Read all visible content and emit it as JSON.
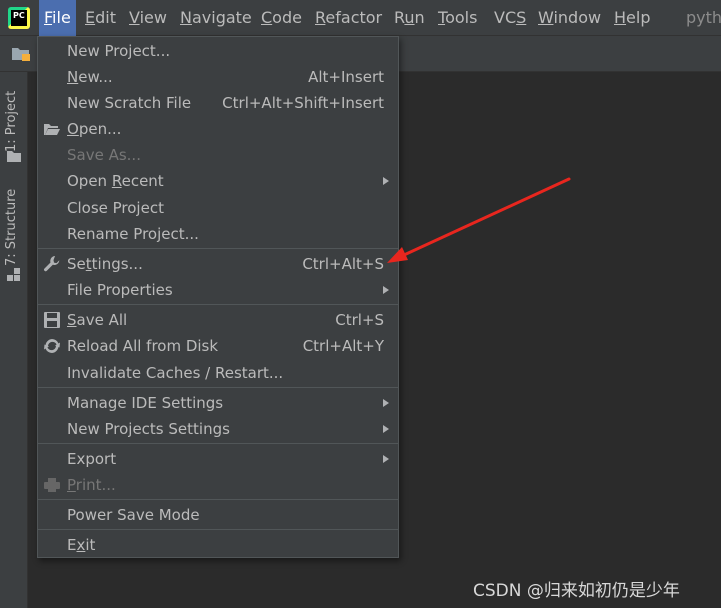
{
  "app": {
    "logo_text": "PC",
    "project_name": "pyth"
  },
  "menubar": [
    {
      "pre": "",
      "mn": "F",
      "post": "ile"
    },
    {
      "pre": "",
      "mn": "E",
      "post": "dit"
    },
    {
      "pre": "",
      "mn": "V",
      "post": "iew"
    },
    {
      "pre": "",
      "mn": "N",
      "post": "avigate"
    },
    {
      "pre": "",
      "mn": "C",
      "post": "ode"
    },
    {
      "pre": "",
      "mn": "R",
      "post": "efactor"
    },
    {
      "pre": "R",
      "mn": "u",
      "post": "n"
    },
    {
      "pre": "",
      "mn": "T",
      "post": "ools"
    },
    {
      "pre": "VC",
      "mn": "S",
      "post": ""
    },
    {
      "pre": "",
      "mn": "W",
      "post": "indow"
    },
    {
      "pre": "",
      "mn": "H",
      "post": "elp"
    }
  ],
  "sidebar": {
    "project_tab": "1: Project",
    "structure_tab": "7: Structure"
  },
  "file_menu": {
    "items": [
      {
        "pre": "New Project...",
        "mn": "",
        "post": "",
        "shortcut": ""
      },
      {
        "pre": "",
        "mn": "N",
        "post": "ew...",
        "shortcut": "Alt+Insert"
      },
      {
        "pre": "New Scratch File",
        "mn": "",
        "post": "",
        "shortcut": "Ctrl+Alt+Shift+Insert"
      },
      {
        "pre": "",
        "mn": "O",
        "post": "pen...",
        "shortcut": ""
      },
      {
        "pre": "Save As...",
        "mn": "",
        "post": "",
        "shortcut": ""
      },
      {
        "pre": "Open ",
        "mn": "R",
        "post": "ecent",
        "shortcut": ""
      },
      {
        "pre": "Close Project",
        "mn": "",
        "post": "",
        "shortcut": ""
      },
      {
        "pre": "Rename Project...",
        "mn": "",
        "post": "",
        "shortcut": ""
      },
      {
        "pre": "Se",
        "mn": "t",
        "post": "tings...",
        "shortcut": "Ctrl+Alt+S"
      },
      {
        "pre": "File Properties",
        "mn": "",
        "post": "",
        "shortcut": ""
      },
      {
        "pre": "",
        "mn": "S",
        "post": "ave All",
        "shortcut": "Ctrl+S"
      },
      {
        "pre": "Reload All from Disk",
        "mn": "",
        "post": "",
        "shortcut": "Ctrl+Alt+Y"
      },
      {
        "pre": "Invalidate Caches / Restart...",
        "mn": "",
        "post": "",
        "shortcut": ""
      },
      {
        "pre": "Manage IDE Settings",
        "mn": "",
        "post": "",
        "shortcut": ""
      },
      {
        "pre": "New Projects Settings",
        "mn": "",
        "post": "",
        "shortcut": ""
      },
      {
        "pre": "Export",
        "mn": "",
        "post": "",
        "shortcut": ""
      },
      {
        "pre": "",
        "mn": "P",
        "post": "rint...",
        "shortcut": ""
      },
      {
        "pre": "Power Save Mode",
        "mn": "",
        "post": "",
        "shortcut": ""
      },
      {
        "pre": "E",
        "mn": "x",
        "post": "it",
        "shortcut": ""
      }
    ]
  },
  "colors": {
    "highlight": "#4b6eaf",
    "annotation_arrow": "#e8261e"
  },
  "watermark": "CSDN @归来如初仍是少年"
}
